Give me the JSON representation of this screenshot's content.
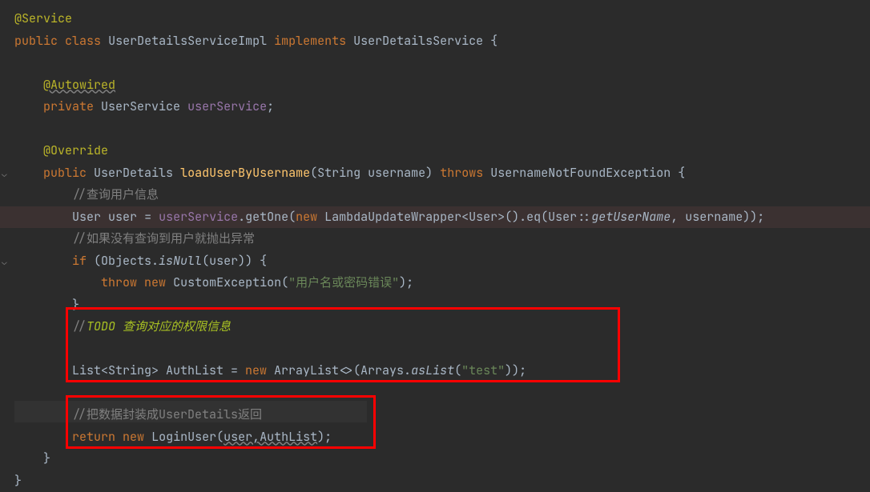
{
  "gutter": {
    "fold1_top": "205",
    "fold2_top": "315"
  },
  "code": {
    "l1_annotation": "@Service",
    "l2_kw_public": "public",
    "l2_kw_class": "class",
    "l2_classname": "UserDetailsServiceImpl",
    "l2_kw_implements": "implements",
    "l2_interface": "UserDetailsService",
    "l2_brace": " {",
    "l4_annotation": "@Autowired",
    "l5_kw_private": "private",
    "l5_type": "UserService",
    "l5_field": "userService",
    "l5_semi": ";",
    "l7_annotation": "@Override",
    "l8_kw_public": "public",
    "l8_rettype": "UserDetails",
    "l8_method": "loadUserByUsername",
    "l8_paren_open": "(",
    "l8_paramtype": "String",
    "l8_paramname": "username",
    "l8_paren_close": ")",
    "l8_kw_throws": "throws",
    "l8_exception": "UsernameNotFoundException",
    "l8_brace": " {",
    "l9_comment": "//查询用户信息",
    "l10_type": "User",
    "l10_var": "user",
    "l10_eq": " = ",
    "l10_field": "userService",
    "l10_dot1": ".",
    "l10_getone": "getOne",
    "l10_paren1": "(",
    "l10_kw_new": "new",
    "l10_wrapper": " LambdaUpdateWrapper<User>().eq(User",
    "l10_colons": "::",
    "l10_methodref": "getUserName",
    "l10_comma": ", username));",
    "l11_comment": "//如果没有查询到用户就抛出异常",
    "l12_kw_if": "if",
    "l12_cond_open": " (Objects.",
    "l12_isnull": "isNull",
    "l12_cond_close": "(user)) {",
    "l13_kw_throw": "throw",
    "l13_kw_new": "new",
    "l13_exc": " CustomException(",
    "l13_str": "\"用户名或密码错误\"",
    "l13_close": ");",
    "l14_brace": "}",
    "l15_slash": "//",
    "l15_todo": "TODO 查询对应的权限信息",
    "l17_list_open": "List<String> AuthList = ",
    "l17_kw_new": "new",
    "l17_arraylist": " ArrayList<>(Arrays.",
    "l17_aslist": "asList",
    "l17_paren": "(",
    "l17_str": "\"test\"",
    "l17_close": "));",
    "l19_comment": "//把数据封装成UserDetails返回",
    "l20_kw_return": "return",
    "l20_kw_new": "new",
    "l20_loginuser": " LoginUser(",
    "l20_args": "user,AuthList",
    "l20_close": ");",
    "l21_brace": "}",
    "l22_brace": "}"
  }
}
